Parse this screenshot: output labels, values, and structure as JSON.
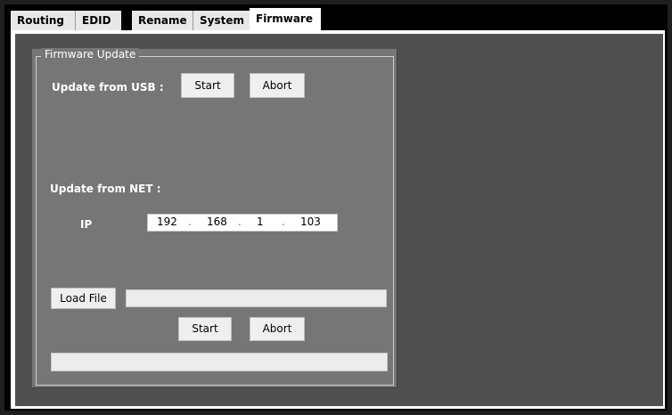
{
  "tabs": [
    {
      "label": "Routing",
      "active": false
    },
    {
      "label": "EDID",
      "active": false
    },
    {
      "label": "Rename",
      "active": false
    },
    {
      "label": "System",
      "active": false
    },
    {
      "label": "Firmware",
      "active": true
    }
  ],
  "firmware_update": {
    "group_title": "Firmware Update",
    "usb": {
      "label": "Update from USB :",
      "start_label": "Start",
      "abort_label": "Abort"
    },
    "net": {
      "label": "Update from NET :",
      "ip_label": "IP",
      "ip_octets": [
        "192",
        "168",
        "1",
        "103"
      ],
      "load_file_label": "Load File",
      "file_path_value": "",
      "start_label": "Start",
      "abort_label": "Abort",
      "progress": 0
    }
  },
  "colors": {
    "panel": "#767676",
    "background": "#505050",
    "button": "#efefef",
    "active_tab": "#ffffff"
  }
}
